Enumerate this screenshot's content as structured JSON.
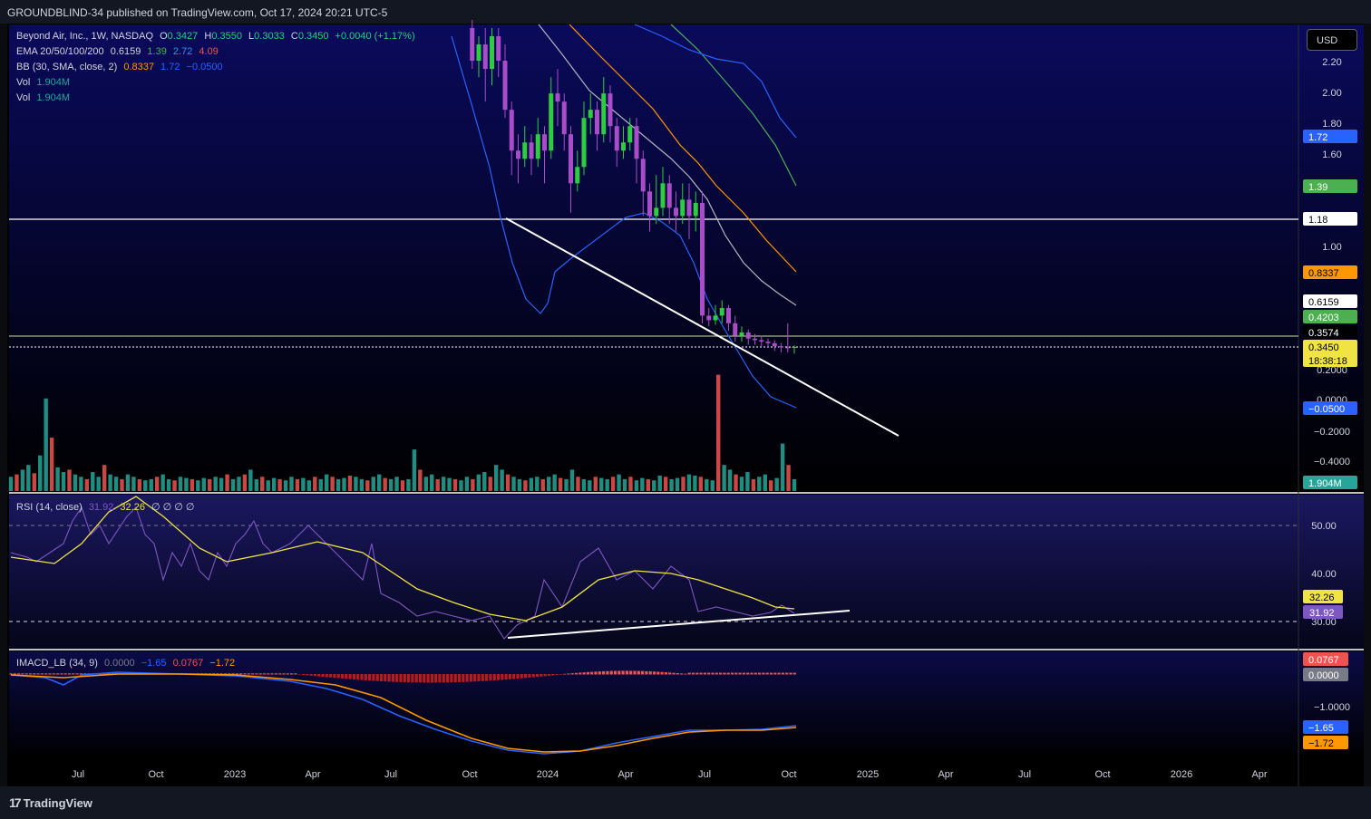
{
  "publish_line": "GROUNDBLIND-34 published on TradingView.com, Oct 17, 2024 20:21 UTC-5",
  "brand": "TradingView",
  "currency": "USD",
  "legend": {
    "symbol": "Beyond Air, Inc., 1W, NASDAQ",
    "o_label": "O",
    "o_val": "0.3427",
    "h_label": "H",
    "h_val": "0.3550",
    "l_label": "L",
    "l_val": "0.3033",
    "c_label": "C",
    "c_val": "0.3450",
    "change": "+0.0040 (+1.17%)",
    "ema_label": "EMA 20/50/100/200",
    "ema_v1": "0.6159",
    "ema_v2": "1.39",
    "ema_v3": "2.72",
    "ema_v4": "4.09",
    "bb_label": "BB (30, SMA, close, 2)",
    "bb_v1": "0.8337",
    "bb_v2": "1.72",
    "bb_v3": "−0.0500",
    "vol_label": "Vol",
    "vol_val": "1.904M",
    "vol2_label": "Vol",
    "vol2_val": "1.904M",
    "rsi_label": "RSI (14, close)",
    "rsi_v1": "31.92",
    "rsi_v2": "32.26",
    "rsi_rest": "∅ ∅ ∅ ∅",
    "macd_label": "IMACD_LB (34, 9)",
    "macd_v1": "0.0000",
    "macd_v2": "−1.65",
    "macd_v3": "0.0767",
    "macd_v4": "−1.72"
  },
  "colors": {
    "up": "#26a69a",
    "down": "#ef5350",
    "bull_candle": "#2ecc40",
    "bear_candle": "#a84cc7",
    "bb": "#2962ff",
    "ema20": "#b2b5be",
    "ema50": "#ff9800",
    "ema100": "#4caf50",
    "ema200": "#2962ff",
    "rsi": "#7e57c2",
    "rsi_ma": "#f0e442",
    "macd": "#2962ff",
    "signal": "#ff9800"
  },
  "chart_data": [
    {
      "type": "candlestick",
      "name_pane": "price",
      "ylim": [
        -0.3,
        2.3
      ],
      "y_ticks": [
        "2.20",
        "2.00",
        "1.80",
        "1.60",
        "1.00",
        "0.2000",
        "0.0000",
        "−0.2000",
        "−0.4000"
      ],
      "x_ticks": [
        "Jul",
        "Oct",
        "2023",
        "Apr",
        "Jul",
        "Oct",
        "2024",
        "Apr",
        "Jul",
        "Oct",
        "2025",
        "Apr",
        "Jul",
        "Oct",
        "2026",
        "Apr"
      ],
      "horizontal_levels": [
        1.18,
        0.3574,
        0.345
      ],
      "price_labels": [
        {
          "text": "1.72",
          "color": "#2962ff",
          "value": 1.72
        },
        {
          "text": "1.39",
          "color": "#4caf50",
          "value": 1.39
        },
        {
          "text": "1.18",
          "color": "#ffffff",
          "value": 1.18
        },
        {
          "text": "0.8337",
          "color": "#ff9800",
          "value": 0.8337
        },
        {
          "text": "0.6159",
          "color": "#ffffff",
          "value": 0.6159
        },
        {
          "text": "0.4203",
          "color": "#4caf50",
          "value": 0.4203
        },
        {
          "text": "0.3574",
          "color": "#ffffff",
          "value": 0.3574
        },
        {
          "text": "0.3450",
          "color": "#f0e442",
          "value": 0.345
        },
        {
          "text": "−0.0500",
          "color": "#2962ff",
          "value": -0.05
        },
        {
          "text": "1.904M",
          "color": "#26a69a",
          "value": -0.5
        }
      ],
      "countdown": "18:38:18",
      "candles": [
        [
          2.35,
          2.15,
          2.4,
          2.1
        ],
        [
          2.15,
          2.25,
          2.3,
          2.05
        ],
        [
          2.25,
          2.1,
          2.35,
          1.9
        ],
        [
          2.1,
          2.3,
          2.35,
          2.0
        ],
        [
          2.3,
          2.15,
          2.35,
          2.05
        ],
        [
          2.15,
          1.85,
          2.25,
          1.8
        ],
        [
          1.85,
          1.6,
          1.9,
          1.45
        ],
        [
          1.6,
          1.55,
          1.7,
          1.4
        ],
        [
          1.55,
          1.65,
          1.75,
          1.5
        ],
        [
          1.65,
          1.55,
          1.7,
          1.45
        ],
        [
          1.55,
          1.7,
          1.8,
          1.5
        ],
        [
          1.7,
          1.6,
          1.75,
          1.4
        ],
        [
          1.6,
          1.95,
          2.05,
          1.55
        ],
        [
          1.95,
          1.9,
          2.1,
          1.75
        ],
        [
          1.9,
          1.7,
          1.95,
          1.6
        ],
        [
          1.7,
          1.4,
          1.75,
          1.22
        ],
        [
          1.4,
          1.5,
          1.6,
          1.35
        ],
        [
          1.5,
          1.8,
          1.9,
          1.45
        ],
        [
          1.8,
          1.85,
          1.95,
          1.7
        ],
        [
          1.85,
          1.7,
          1.9,
          1.6
        ],
        [
          1.7,
          1.95,
          2.05,
          1.65
        ],
        [
          1.95,
          1.75,
          2.0,
          1.65
        ],
        [
          1.75,
          1.6,
          1.8,
          1.5
        ],
        [
          1.6,
          1.65,
          1.75,
          1.55
        ],
        [
          1.65,
          1.75,
          1.8,
          1.6
        ],
        [
          1.75,
          1.55,
          1.8,
          1.4
        ],
        [
          1.55,
          1.35,
          1.6,
          1.2
        ],
        [
          1.35,
          1.2,
          1.4,
          1.1
        ],
        [
          1.2,
          1.25,
          1.45,
          1.15
        ],
        [
          1.25,
          1.4,
          1.5,
          1.2
        ],
        [
          1.4,
          1.25,
          1.45,
          1.15
        ],
        [
          1.25,
          1.2,
          1.35,
          1.1
        ],
        [
          1.2,
          1.3,
          1.4,
          1.15
        ],
        [
          1.3,
          1.2,
          1.4,
          1.05
        ],
        [
          1.2,
          1.28,
          1.35,
          1.1
        ],
        [
          1.28,
          0.55,
          1.35,
          0.5
        ],
        [
          0.55,
          0.52,
          0.6,
          0.48
        ],
        [
          0.52,
          0.55,
          0.62,
          0.49
        ],
        [
          0.55,
          0.6,
          0.65,
          0.5
        ],
        [
          0.6,
          0.5,
          0.62,
          0.45
        ],
        [
          0.5,
          0.42,
          0.55,
          0.38
        ],
        [
          0.42,
          0.44,
          0.48,
          0.38
        ],
        [
          0.44,
          0.4,
          0.46,
          0.36
        ],
        [
          0.4,
          0.39,
          0.43,
          0.36
        ],
        [
          0.39,
          0.38,
          0.42,
          0.35
        ],
        [
          0.38,
          0.37,
          0.4,
          0.34
        ],
        [
          0.37,
          0.35,
          0.39,
          0.32
        ],
        [
          0.35,
          0.3427,
          0.37,
          0.31
        ],
        [
          0.3427,
          0.341,
          0.5,
          0.31
        ],
        [
          0.3427,
          0.345,
          0.355,
          0.3033
        ]
      ]
    },
    {
      "type": "bar",
      "name_pane": "volume",
      "values": [
        12,
        14,
        18,
        22,
        15,
        30,
        78,
        45,
        20,
        16,
        18,
        14,
        12,
        10,
        16,
        12,
        22,
        14,
        12,
        10,
        14,
        12,
        10,
        9,
        10,
        12,
        14,
        10,
        9,
        12,
        11,
        10,
        9,
        11,
        10,
        12,
        11,
        14,
        10,
        12,
        14,
        18,
        10,
        12,
        9,
        11,
        10,
        9,
        12,
        10,
        11,
        9,
        12,
        10,
        14,
        12,
        10,
        11,
        13,
        12,
        10,
        9,
        12,
        14,
        11,
        10,
        12,
        9,
        10,
        35,
        18,
        12,
        14,
        10,
        12,
        11,
        10,
        9,
        12,
        10,
        14,
        16,
        12,
        22,
        18,
        14,
        12,
        10,
        9,
        11,
        12,
        10,
        12,
        14,
        11,
        10,
        18,
        12,
        10,
        9,
        12,
        11,
        10,
        12,
        14,
        10,
        12,
        9,
        11,
        10,
        9,
        13,
        12,
        10,
        11,
        12,
        14,
        13,
        12,
        10,
        9,
        98,
        22,
        18,
        14,
        12,
        16,
        10,
        12,
        14,
        9,
        11,
        40,
        22,
        10
      ]
    },
    {
      "type": "line",
      "name_pane": "rsi",
      "ylim": [
        22,
        57
      ],
      "y_ticks": [
        "50.00",
        "40.00",
        "30.00"
      ],
      "levels": [
        50,
        30
      ],
      "price_labels": [
        {
          "text": "32.26",
          "value": 32.26
        },
        {
          "text": "31.92",
          "value": 31.92
        }
      ]
    },
    {
      "type": "line",
      "name_pane": "macd",
      "ylim": [
        -2.1,
        0.2
      ],
      "y_ticks": [
        "−1.0000"
      ],
      "price_labels": [
        {
          "text": "0.0767",
          "value": 0.0767
        },
        {
          "text": "0.0000",
          "value": 0.0
        },
        {
          "text": "−1.65",
          "value": -1.65
        },
        {
          "text": "−1.72",
          "value": -1.72
        }
      ]
    }
  ]
}
